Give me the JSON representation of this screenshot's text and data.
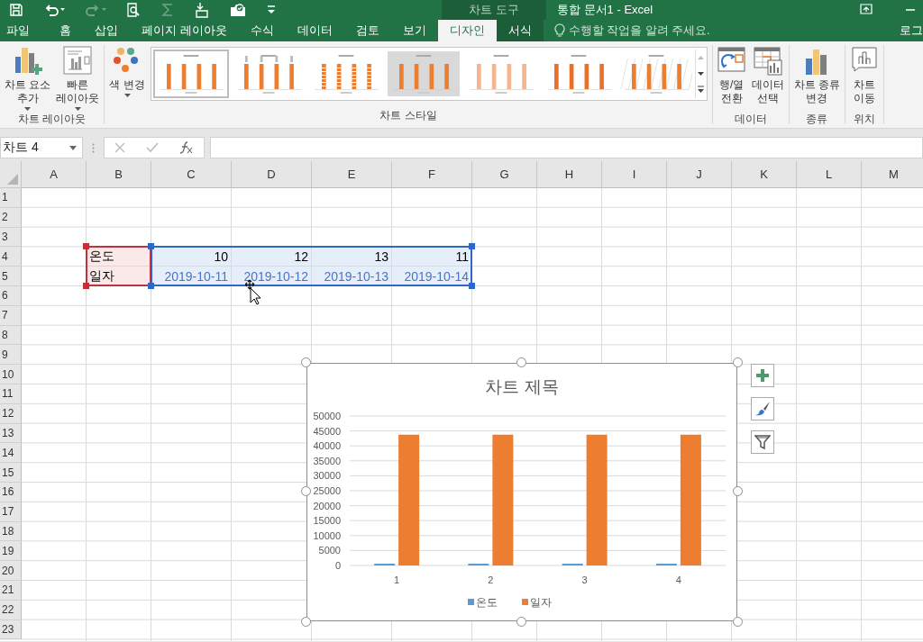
{
  "title_bar": {
    "quick_access": [
      {
        "kind": "save",
        "disabled": false
      },
      {
        "kind": "undo",
        "disabled": false
      },
      {
        "kind": "redo",
        "disabled": true
      },
      {
        "kind": "preview",
        "disabled": false
      },
      {
        "kind": "sum",
        "disabled": true
      },
      {
        "kind": "touch",
        "disabled": false
      },
      {
        "kind": "camera",
        "disabled": false
      },
      {
        "kind": "customize",
        "disabled": false
      }
    ],
    "context_label": "차트 도구",
    "title": "통합 문서1 - Excel"
  },
  "tabs": [
    {
      "label": "파일",
      "selected": false,
      "contextual": false
    },
    {
      "label": "홈",
      "selected": false,
      "contextual": false
    },
    {
      "label": "삽입",
      "selected": false,
      "contextual": false
    },
    {
      "label": "페이지 레이아웃",
      "selected": false,
      "contextual": false
    },
    {
      "label": "수식",
      "selected": false,
      "contextual": false
    },
    {
      "label": "데이터",
      "selected": false,
      "contextual": false
    },
    {
      "label": "검토",
      "selected": false,
      "contextual": false
    },
    {
      "label": "보기",
      "selected": false,
      "contextual": false
    },
    {
      "label": "디자인",
      "selected": true,
      "contextual": true
    },
    {
      "label": "서식",
      "selected": false,
      "contextual": true
    }
  ],
  "tell_me": {
    "placeholder": "수행할 작업을 알려 주세요."
  },
  "account": "로그",
  "ribbon": {
    "groups": [
      {
        "label": "차트 레이아웃",
        "items": [
          {
            "kind": "add-element",
            "label": "차트 요소\n추가",
            "dropdown": true
          },
          {
            "kind": "quick-layout",
            "label": "빠른\n레이아웃",
            "dropdown": true
          }
        ]
      },
      {
        "label": "차트 스타일",
        "items": [
          {
            "kind": "color",
            "label": "색 변경",
            "dropdown": true
          },
          {
            "kind": "gallery",
            "styles": [
              {
                "selected": true
              },
              {
                "selected": false
              },
              {
                "selected": false
              },
              {
                "selected": false
              },
              {
                "selected": false
              },
              {
                "selected": false
              },
              {
                "selected": false
              }
            ]
          }
        ]
      },
      {
        "label": "데이터",
        "items": [
          {
            "kind": "switch",
            "label": "행/열\n전환",
            "dropdown": false
          },
          {
            "kind": "select-data",
            "label": "데이터\n선택",
            "dropdown": false
          }
        ]
      },
      {
        "label": "종류",
        "items": [
          {
            "kind": "change-type",
            "label": "차트 종류\n변경",
            "dropdown": false
          }
        ]
      },
      {
        "label": "위치",
        "items": [
          {
            "kind": "move-chart",
            "label": "차트\n이동",
            "dropdown": false
          }
        ]
      }
    ]
  },
  "formula_bar": {
    "name_box": "차트 4"
  },
  "sheet": {
    "columns": [
      "A",
      "B",
      "C",
      "D",
      "E",
      "F",
      "G",
      "H",
      "I",
      "J",
      "K",
      "L",
      "M"
    ],
    "rows": [
      {
        "label": "1"
      },
      {
        "label": "2"
      },
      {
        "label": "3"
      },
      {
        "label": "4",
        "cells": [
          {},
          {
            "text": "온도",
            "kind": "name"
          },
          {
            "text": "10",
            "kind": "value"
          },
          {
            "text": "12",
            "kind": "value"
          },
          {
            "text": "13",
            "kind": "value"
          },
          {
            "text": "11",
            "kind": "value"
          }
        ]
      },
      {
        "label": "5",
        "cells": [
          {},
          {
            "text": "일자",
            "kind": "name"
          },
          {
            "text": "2019-10-11",
            "kind": "category"
          },
          {
            "text": "2019-10-12",
            "kind": "category"
          },
          {
            "text": "2019-10-13",
            "kind": "category"
          },
          {
            "text": "2019-10-14",
            "kind": "category"
          }
        ]
      },
      {
        "label": "6"
      },
      {
        "label": "7"
      },
      {
        "label": "8"
      },
      {
        "label": "9"
      },
      {
        "label": "10"
      },
      {
        "label": "11"
      },
      {
        "label": "12"
      },
      {
        "label": "13"
      },
      {
        "label": "14"
      },
      {
        "label": "15"
      },
      {
        "label": "16"
      },
      {
        "label": "17"
      },
      {
        "label": "18"
      },
      {
        "label": "19"
      },
      {
        "label": "20"
      },
      {
        "label": "21"
      },
      {
        "label": "22"
      },
      {
        "label": "23"
      }
    ]
  },
  "chart": {
    "selected": true,
    "buttons": [
      {
        "kind": "elements"
      },
      {
        "kind": "styles"
      },
      {
        "kind": "filter"
      }
    ],
    "chart_data": {
      "type": "bar",
      "title": "차트 제목",
      "categories": [
        "1",
        "2",
        "3",
        "4"
      ],
      "series": [
        {
          "name": "온도",
          "color": "#5b9bd5",
          "values": [
            10,
            12,
            13,
            11
          ]
        },
        {
          "name": "일자",
          "color": "#ed7d31",
          "values": [
            43750,
            43750,
            43750,
            43750
          ]
        }
      ],
      "ylim": [
        0,
        50000
      ],
      "yticks": [
        0,
        5000,
        10000,
        15000,
        20000,
        25000,
        30000,
        35000,
        40000,
        45000,
        50000
      ],
      "grid": true
    }
  }
}
